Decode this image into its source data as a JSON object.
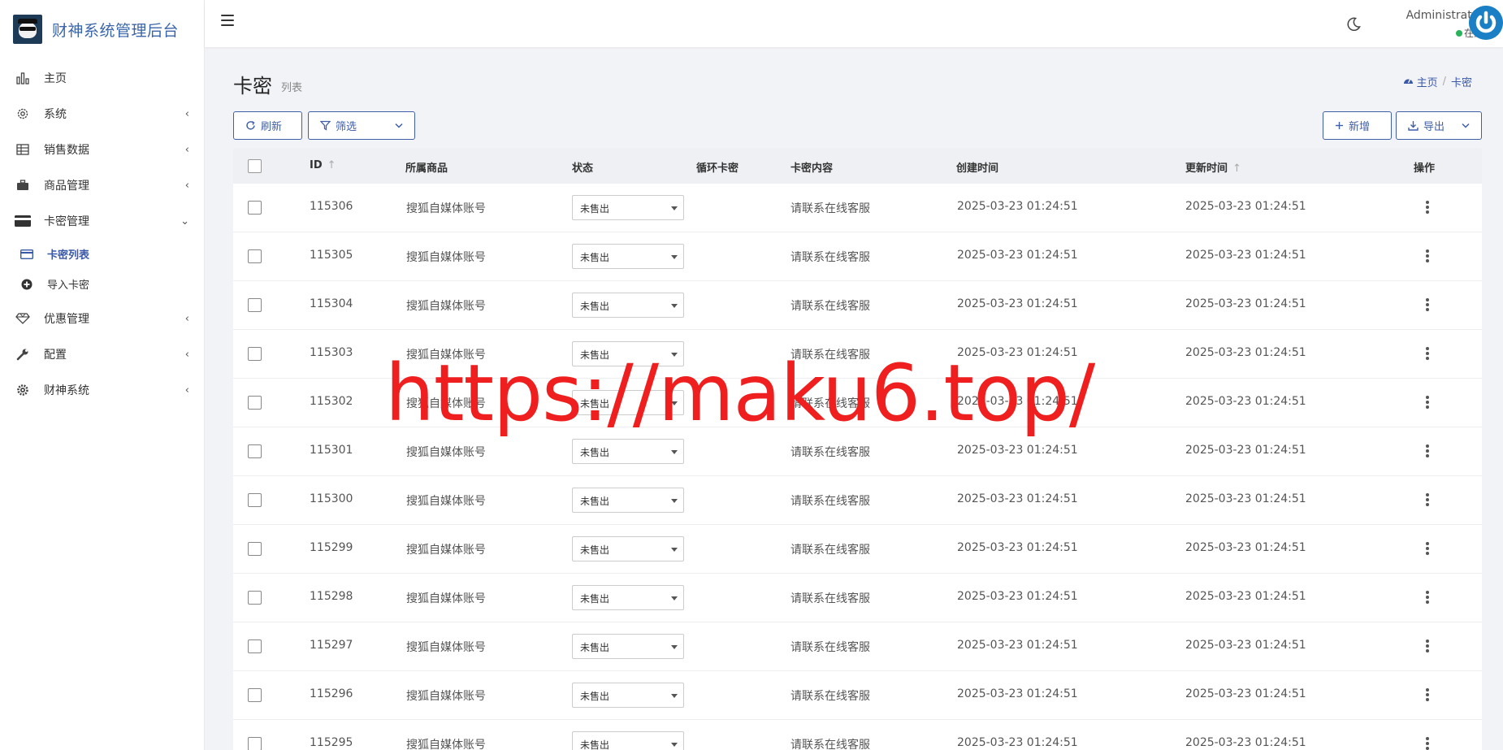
{
  "brand": {
    "title": "财神系统管理后台"
  },
  "sidebar": {
    "items": [
      {
        "label": "主页",
        "icon": "bar-chart-icon",
        "arrow": ""
      },
      {
        "label": "系统",
        "icon": "gear-icon",
        "arrow": "‹"
      },
      {
        "label": "销售数据",
        "icon": "table-icon",
        "arrow": "‹"
      },
      {
        "label": "商品管理",
        "icon": "briefcase-icon",
        "arrow": "‹"
      },
      {
        "label": "卡密管理",
        "icon": "credit-card-icon",
        "arrow": "⌄"
      },
      {
        "label": "优惠管理",
        "icon": "diamond-icon",
        "arrow": "‹"
      },
      {
        "label": "配置",
        "icon": "wrench-icon",
        "arrow": "‹"
      },
      {
        "label": "财神系统",
        "icon": "cog-icon",
        "arrow": "‹"
      }
    ],
    "sub": [
      {
        "label": "卡密列表",
        "icon": "credit-card-icon",
        "active": true
      },
      {
        "label": "导入卡密",
        "icon": "plus-circle-icon",
        "active": false
      }
    ]
  },
  "header": {
    "user_name": "Administrator",
    "user_status": "在线",
    "status_color": "#29b35a"
  },
  "page": {
    "title": "卡密",
    "subtitle": "列表",
    "breadcrumb": {
      "home": "主页",
      "current": "卡密"
    }
  },
  "toolbar": {
    "refresh": "刷新",
    "filter": "筛选",
    "add": "新增",
    "export": "导出"
  },
  "table": {
    "headers": {
      "id": "ID",
      "product": "所属商品",
      "status": "状态",
      "loop": "循环卡密",
      "content": "卡密内容",
      "created": "创建时间",
      "updated": "更新时间",
      "actions": "操作"
    },
    "rows": [
      {
        "id": "115306",
        "product": "搜狐自媒体账号",
        "status": "未售出",
        "content": "请联系在线客服",
        "created": "2025-03-23 01:24:51",
        "updated": "2025-03-23 01:24:51"
      },
      {
        "id": "115305",
        "product": "搜狐自媒体账号",
        "status": "未售出",
        "content": "请联系在线客服",
        "created": "2025-03-23 01:24:51",
        "updated": "2025-03-23 01:24:51"
      },
      {
        "id": "115304",
        "product": "搜狐自媒体账号",
        "status": "未售出",
        "content": "请联系在线客服",
        "created": "2025-03-23 01:24:51",
        "updated": "2025-03-23 01:24:51"
      },
      {
        "id": "115303",
        "product": "搜狐自媒体账号",
        "status": "未售出",
        "content": "请联系在线客服",
        "created": "2025-03-23 01:24:51",
        "updated": "2025-03-23 01:24:51"
      },
      {
        "id": "115302",
        "product": "搜狐自媒体账号",
        "status": "未售出",
        "content": "请联系在线客服",
        "created": "2025-03-23 01:24:51",
        "updated": "2025-03-23 01:24:51"
      },
      {
        "id": "115301",
        "product": "搜狐自媒体账号",
        "status": "未售出",
        "content": "请联系在线客服",
        "created": "2025-03-23 01:24:51",
        "updated": "2025-03-23 01:24:51"
      },
      {
        "id": "115300",
        "product": "搜狐自媒体账号",
        "status": "未售出",
        "content": "请联系在线客服",
        "created": "2025-03-23 01:24:51",
        "updated": "2025-03-23 01:24:51"
      },
      {
        "id": "115299",
        "product": "搜狐自媒体账号",
        "status": "未售出",
        "content": "请联系在线客服",
        "created": "2025-03-23 01:24:51",
        "updated": "2025-03-23 01:24:51"
      },
      {
        "id": "115298",
        "product": "搜狐自媒体账号",
        "status": "未售出",
        "content": "请联系在线客服",
        "created": "2025-03-23 01:24:51",
        "updated": "2025-03-23 01:24:51"
      },
      {
        "id": "115297",
        "product": "搜狐自媒体账号",
        "status": "未售出",
        "content": "请联系在线客服",
        "created": "2025-03-23 01:24:51",
        "updated": "2025-03-23 01:24:51"
      },
      {
        "id": "115296",
        "product": "搜狐自媒体账号",
        "status": "未售出",
        "content": "请联系在线客服",
        "created": "2025-03-23 01:24:51",
        "updated": "2025-03-23 01:24:51"
      },
      {
        "id": "115295",
        "product": "搜狐自媒体账号",
        "status": "未售出",
        "content": "请联系在线客服",
        "created": "2025-03-23 01:24:51",
        "updated": "2025-03-23 01:24:51"
      }
    ]
  },
  "watermark": "https://maku6.top/",
  "colors": {
    "accent": "#3f5fa8",
    "watermark": "#ef1f1f",
    "avatar": "#1a7fc4"
  }
}
